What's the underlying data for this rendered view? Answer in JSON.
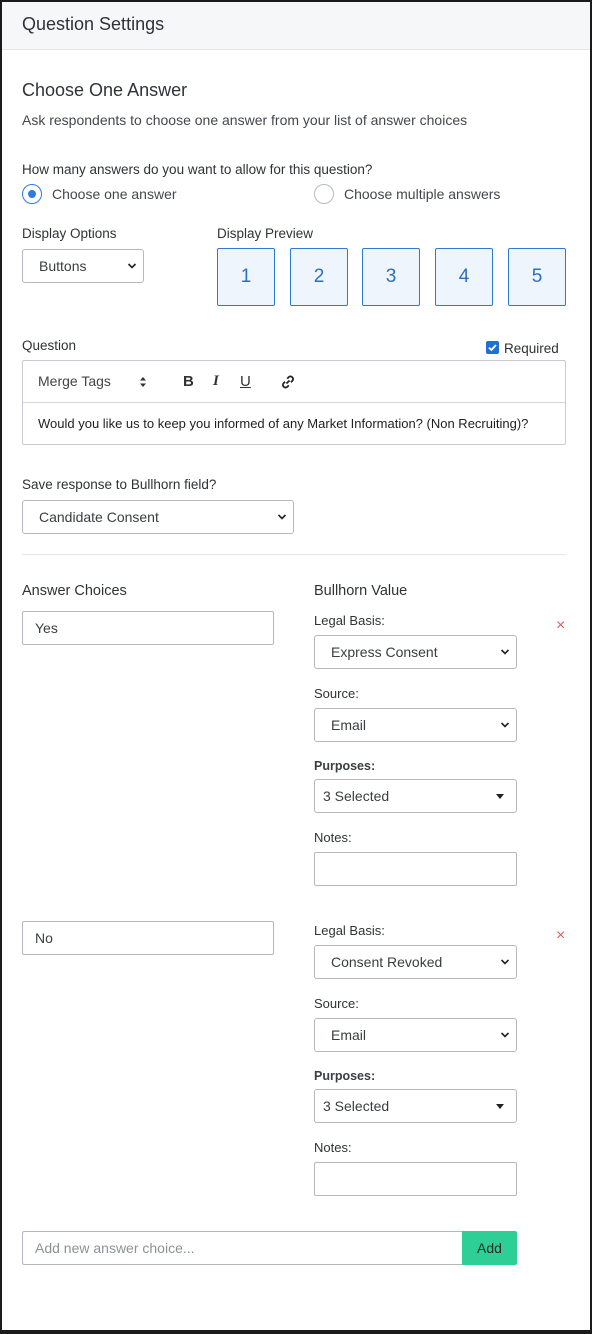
{
  "header": {
    "title": "Question Settings"
  },
  "section": {
    "title": "Choose One Answer",
    "description": "Ask respondents to choose one answer from your list of answer choices"
  },
  "answers_allowed": {
    "label": "How many answers do you want to allow for this question?",
    "options": [
      {
        "label": "Choose one answer",
        "selected": true
      },
      {
        "label": "Choose multiple answers",
        "selected": false
      }
    ]
  },
  "display": {
    "options_label": "Display Options",
    "options_value": "Buttons",
    "preview_label": "Display Preview",
    "preview_buttons": [
      "1",
      "2",
      "3",
      "4",
      "5"
    ]
  },
  "question": {
    "label": "Question",
    "required_label": "Required",
    "required_checked": true,
    "toolbar": {
      "merge_tags": "Merge Tags",
      "bold": "B",
      "italic": "I",
      "underline": "U",
      "link_icon": "link-icon"
    },
    "text": "Would you like us to keep you informed of any Market Information? (Non Recruiting)?"
  },
  "bullhorn_field": {
    "label": "Save response to Bullhorn field?",
    "value": "Candidate Consent"
  },
  "answers": {
    "choices_header": "Answer Choices",
    "value_header": "Bullhorn Value",
    "legal_basis_label": "Legal Basis:",
    "source_label": "Source:",
    "purposes_label": "Purposes:",
    "notes_label": "Notes:",
    "remove_glyph": "×",
    "items": [
      {
        "choice": "Yes",
        "legal_basis": "Express Consent",
        "source": "Email",
        "purposes": "3 Selected",
        "notes": ""
      },
      {
        "choice": "No",
        "legal_basis": "Consent Revoked",
        "source": "Email",
        "purposes": "3 Selected",
        "notes": ""
      }
    ]
  },
  "add_answer": {
    "placeholder": "Add new answer choice...",
    "button_label": "Add"
  },
  "colors": {
    "accent": "#2f7be5",
    "add_button": "#2ecf96",
    "remove": "#e35d5d",
    "preview_bg": "#eef5fd"
  }
}
